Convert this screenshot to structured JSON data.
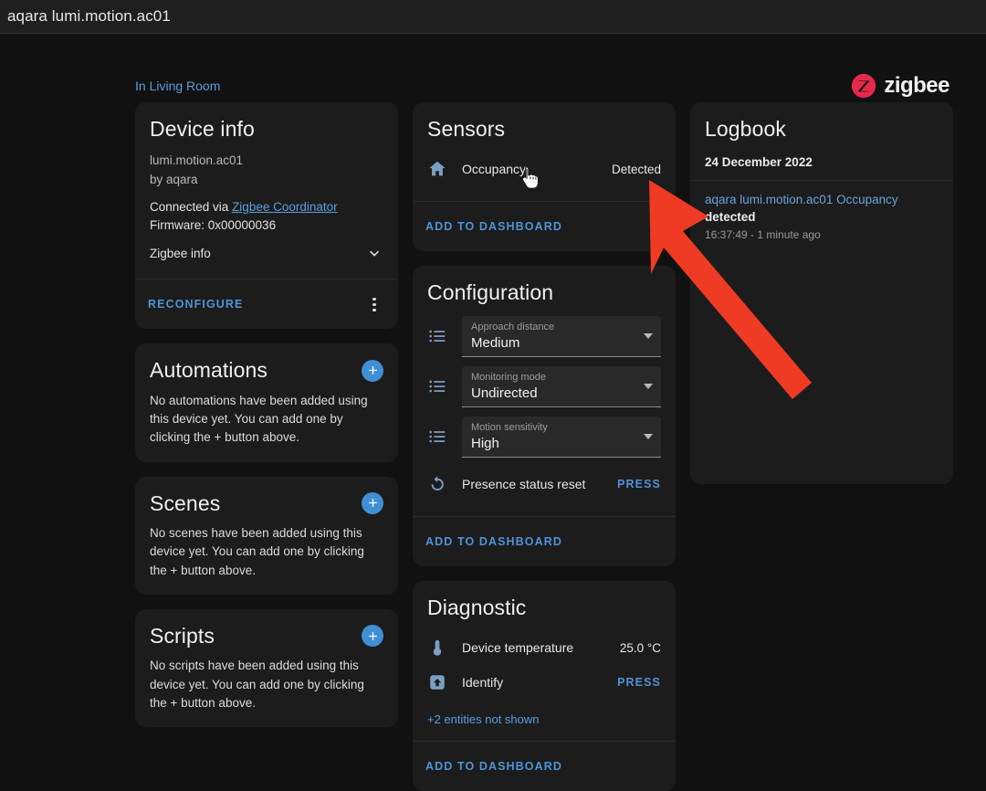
{
  "window": {
    "title": "aqara lumi.motion.ac01"
  },
  "header": {
    "area_link": "In Living Room",
    "brand": {
      "name": "zigbee",
      "icon": "zigbee-logo-icon",
      "color": "#e8284a"
    }
  },
  "theme": {
    "background": "#111111",
    "card": "#1c1c1c",
    "accent": "#4f93d6",
    "link": "#5a9fe0",
    "icon_blue": "#7d9ec4",
    "arrow_annotation": "#ef3b23"
  },
  "device_info": {
    "title": "Device info",
    "model": "lumi.motion.ac01",
    "manufacturer": "by aqara",
    "connected_via_prefix": "Connected via ",
    "connected_via_link": "Zigbee Coordinator",
    "firmware": "Firmware: 0x00000036",
    "expander_label": "Zigbee info",
    "expander_icon": "chevron-down-icon",
    "reconfigure_label": "RECONFIGURE",
    "overflow_icon": "kebab-menu-icon"
  },
  "automations": {
    "title": "Automations",
    "add_icon": "plus-circle-icon",
    "empty_text": "No automations have been added using this device yet. You can add one by clicking the + button above."
  },
  "scenes": {
    "title": "Scenes",
    "add_icon": "plus-circle-icon",
    "empty_text": "No scenes have been added using this device yet. You can add one by clicking the + button above."
  },
  "scripts": {
    "title": "Scripts",
    "add_icon": "plus-circle-icon",
    "empty_text": "No scripts have been added using this device yet. You can add one by clicking the + button above."
  },
  "sensors": {
    "title": "Sensors",
    "rows": [
      {
        "icon": "home-icon",
        "name": "Occupancy",
        "value": "Detected"
      }
    ],
    "add_to_dashboard": "ADD TO DASHBOARD"
  },
  "configuration": {
    "title": "Configuration",
    "selects": [
      {
        "icon": "list-bulleted-icon",
        "label": "Approach distance",
        "value": "Medium",
        "arrow_icon": "dropdown-arrow-icon"
      },
      {
        "icon": "list-bulleted-icon",
        "label": "Monitoring mode",
        "value": "Undirected",
        "arrow_icon": "dropdown-arrow-icon"
      },
      {
        "icon": "list-bulleted-icon",
        "label": "Motion sensitivity",
        "value": "High",
        "arrow_icon": "dropdown-arrow-icon"
      }
    ],
    "button_row": {
      "icon": "restore-icon",
      "name": "Presence status reset",
      "action": "PRESS"
    },
    "add_to_dashboard": "ADD TO DASHBOARD"
  },
  "diagnostic": {
    "title": "Diagnostic",
    "rows": [
      {
        "icon": "thermometer-icon",
        "name": "Device temperature",
        "value": "25.0 °C",
        "type": "value"
      },
      {
        "icon": "identify-icon",
        "name": "Identify",
        "value": "PRESS",
        "type": "action"
      }
    ],
    "more_entities": "+2 entities not shown",
    "add_to_dashboard": "ADD TO DASHBOARD"
  },
  "logbook": {
    "title": "Logbook",
    "date": "24 December 2022",
    "entries": [
      {
        "entity": "aqara lumi.motion.ac01 Occupancy",
        "state": "detected",
        "time": "16:37:49 - 1 minute ago"
      }
    ]
  },
  "annotations": {
    "cursor": "pointer-hand-cursor",
    "arrow": "red-arrow-annotation"
  }
}
